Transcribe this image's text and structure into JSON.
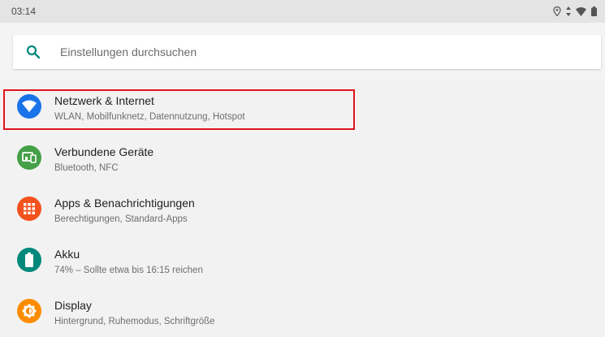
{
  "status": {
    "time": "03:14"
  },
  "search": {
    "placeholder": "Einstellungen durchsuchen"
  },
  "items": [
    {
      "title": "Netzwerk & Internet",
      "subtitle": "WLAN, Mobilfunknetz, Datennutzung, Hotspot",
      "color": "#1a73e8",
      "icon": "wifi-icon"
    },
    {
      "title": "Verbundene Geräte",
      "subtitle": "Bluetooth, NFC",
      "color": "#43a047",
      "icon": "devices-icon"
    },
    {
      "title": "Apps & Benachrichtigungen",
      "subtitle": "Berechtigungen, Standard-Apps",
      "color": "#f4511e",
      "icon": "apps-grid-icon"
    },
    {
      "title": "Akku",
      "subtitle": "74% – Sollte etwa bis 16:15 reichen",
      "color": "#00897b",
      "icon": "battery-icon"
    },
    {
      "title": "Display",
      "subtitle": "Hintergrund, Ruhemodus, Schriftgröße",
      "color": "#fb8c00",
      "icon": "brightness-icon"
    }
  ],
  "colors": {
    "highlight": "#e0141e",
    "search_icon": "#00897b"
  }
}
